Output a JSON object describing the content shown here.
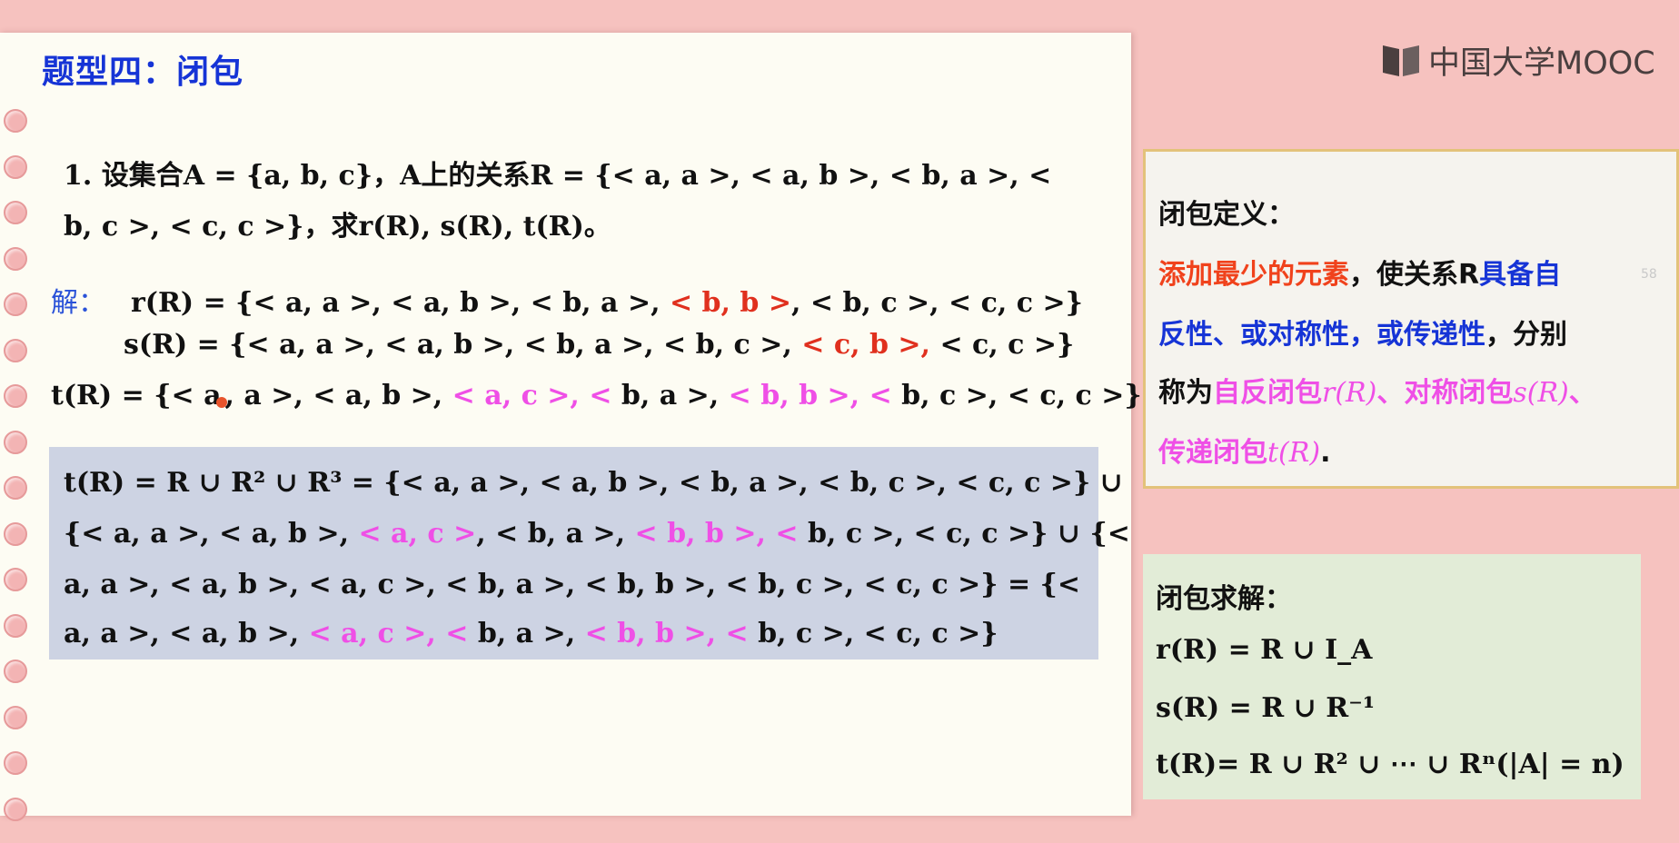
{
  "title": "题型四：闭包",
  "problem": {
    "line1": "1. 设集合A = {a, b, c}，A上的关系R = {< a, a >, < a, b >, < b, a >, <",
    "line2": "b, c >, < c, c >}，求r(R), s(R), t(R)。"
  },
  "solution": {
    "label": "解：",
    "r_prefix": "r(R) = {< a, a >, < a, b >, < b, a >, ",
    "r_added": "< b, b >",
    "r_suffix": ", < b, c >, < c, c >}",
    "s_prefix": "s(R) = {< a, a >, < a, b >, < b, a >, < b, c >, ",
    "s_added": "< c, b >, ",
    "s_suffix": "< c, c >}",
    "t_a": "t(R) = {< a",
    "t_b": ", a >, < a, b >, ",
    "t_c": "< a, c >, <",
    "t_d": " b, a >, ",
    "t_e": "< b, b >, <",
    "t_f": " b, c >, < c, c >}"
  },
  "box": {
    "l1": "t(R) = R ∪ R² ∪ R³ = {< a, a >, < a, b >, < b, a >, < b, c >, < c, c >} ∪",
    "l2_a": "{< a, a >, < a, b >, ",
    "l2_b": "< a, c >",
    "l2_c": ", < b, a >, ",
    "l2_d": "< b, b >, <",
    "l2_e": " b, c >, < c, c >} ∪ {<",
    "l3": "a, a >, < a, b >, < a, c >, < b, a >, < b, b >, < b, c >, < c, c >} = {<",
    "l4_a": "a, a >, < a, b >, ",
    "l4_b": "< a, c >, <",
    "l4_c": " b, a >, ",
    "l4_d": "< b, b >, <",
    "l4_e": " b, c >, < c, c >}"
  },
  "logo": {
    "text": "中国大学MOOC"
  },
  "definition": {
    "heading": "闭包定义：",
    "p1_orange": "添加最少的元素",
    "p1_black": "，使关系R",
    "p1_blue": "具备自",
    "p2_blue1": "反性、或对称性，或传递性",
    "p2_black": "，分别",
    "p3_black": "称为",
    "p3_pink1": "自反闭包",
    "p3_math1": "r(R)",
    "p3_sep": "、",
    "p3_pink2": "对称闭包",
    "p3_math2": "s(R)",
    "p3_sep2": "、",
    "p4_pink": "传递闭包",
    "p4_math": "t(R)",
    "p4_end": "."
  },
  "solve": {
    "heading": "闭包求解：",
    "f1": "r(R) = R ∪ I_A",
    "f2": "s(R) = R ∪ R⁻¹",
    "f3": "t(R)= R ∪ R² ∪ ⋯ ∪ Rⁿ(|A| = n)"
  },
  "page_number": "58",
  "colors": {
    "background": "#f6c2bf",
    "paper": "#fdfcf3",
    "title_blue": "#1634d6",
    "highlight_red": "#e0301e",
    "highlight_magenta": "#ef4fe6",
    "box_bg": "#cdd3e3",
    "card_green": "#e2ecd7"
  }
}
